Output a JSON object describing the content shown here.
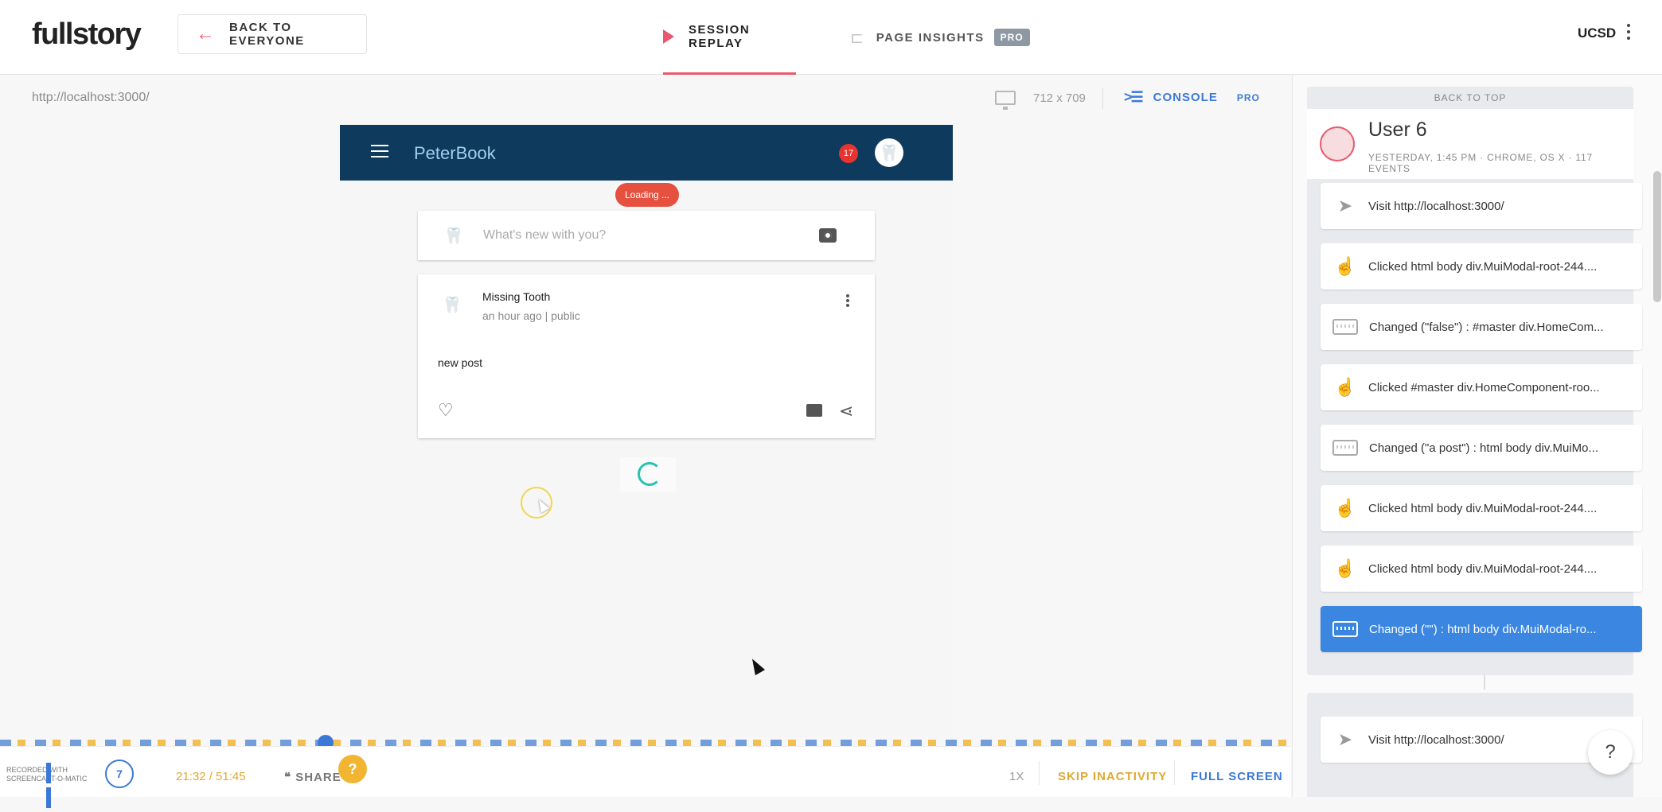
{
  "header": {
    "logo": "fullstory",
    "back_label": "BACK TO EVERYONE",
    "tab_session": "SESSION REPLAY",
    "tab_insights": "PAGE INSIGHTS",
    "insights_badge": "PRO",
    "org": "UCSD"
  },
  "stage": {
    "url": "http://localhost:3000/",
    "dims": "712 x 709",
    "console_label": "CONSOLE",
    "console_badge": "PRO"
  },
  "replay": {
    "app_name": "PeterBook",
    "notification_count": "17",
    "loading": "Loading ...",
    "composer_placeholder": "What's new with you?",
    "post": {
      "author": "Missing Tooth",
      "meta": "an hour ago | public",
      "text": "new post"
    }
  },
  "player": {
    "rewind_seconds": "7",
    "time": "21:32 / 51:45",
    "share_label": "SHARE",
    "help_small": "?",
    "speed": "1X",
    "skip_label": "SKIP INACTIVITY",
    "fullscreen_label": "FULL SCREEN",
    "watermark": "RECORDED WITH SCREENCAST-O-MATIC"
  },
  "panel": {
    "back_top": "BACK TO TOP",
    "user_name": "User 6",
    "user_meta": "YESTERDAY, 1:45 PM · CHROME, OS X · 117 EVENTS",
    "events": [
      {
        "type": "navigate",
        "icon": "navigate-icon",
        "text": "Visit http://localhost:3000/"
      },
      {
        "type": "click",
        "icon": "pointer-hand-icon",
        "text": "Clicked html body div.MuiModal-root-244...."
      },
      {
        "type": "change",
        "icon": "keyboard-icon",
        "text": "Changed (\"false\") : #master div.HomeCom..."
      },
      {
        "type": "click",
        "icon": "pointer-hand-icon",
        "text": "Clicked #master div.HomeComponent-roo..."
      },
      {
        "type": "change",
        "icon": "keyboard-icon",
        "text": "Changed (\"a post\") : html body div.MuiMo..."
      },
      {
        "type": "click",
        "icon": "pointer-hand-icon",
        "text": "Clicked html body div.MuiModal-root-244...."
      },
      {
        "type": "click",
        "icon": "pointer-hand-icon",
        "text": "Clicked html body div.MuiModal-root-244...."
      },
      {
        "type": "change",
        "icon": "keyboard-icon",
        "text": "Changed (\"\") : html body div.MuiModal-ro...",
        "active": true
      },
      {
        "type": "navigate",
        "icon": "navigate-icon",
        "text": "Visit http://localhost:3000/"
      }
    ],
    "help_fab": "?"
  },
  "colors": {
    "accent_pink": "#e8596b",
    "accent_blue": "#3b78d8",
    "accent_gold": "#e0a92e",
    "appbar": "#0d3a5d",
    "active_event": "#3b86e0"
  }
}
